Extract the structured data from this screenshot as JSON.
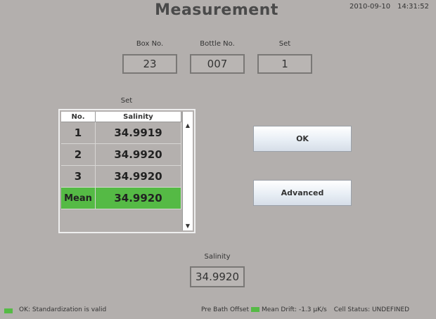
{
  "header": {
    "title": "Measurement",
    "date": "2010-09-10",
    "time": "14:31:52"
  },
  "fields": {
    "box": {
      "label": "Box No.",
      "value": "23"
    },
    "bottle": {
      "label": "Bottle No.",
      "value": "007"
    },
    "set": {
      "label": "Set",
      "value": "1"
    }
  },
  "table": {
    "caption": "Set",
    "headers": [
      "No.",
      "Salinity"
    ],
    "rows": [
      {
        "no": "1",
        "salinity": "34.9919"
      },
      {
        "no": "2",
        "salinity": "34.9920"
      },
      {
        "no": "3",
        "salinity": "34.9920"
      }
    ],
    "mean": {
      "no": "Mean",
      "salinity": "34.9920"
    },
    "highlight_color": "#55ba45"
  },
  "buttons": {
    "ok": "OK",
    "advanced": "Advanced"
  },
  "salinity": {
    "label": "Salinity",
    "value": "34.9920"
  },
  "status": {
    "left_text": "OK: Standardization is valid",
    "pre_bath_offset": "Pre Bath Offset",
    "mean_drift": "Mean Drift:  -1.3 µK/s",
    "cell_status": "Cell Status:   UNDEFINED",
    "indicator_color": "#55ba45"
  }
}
